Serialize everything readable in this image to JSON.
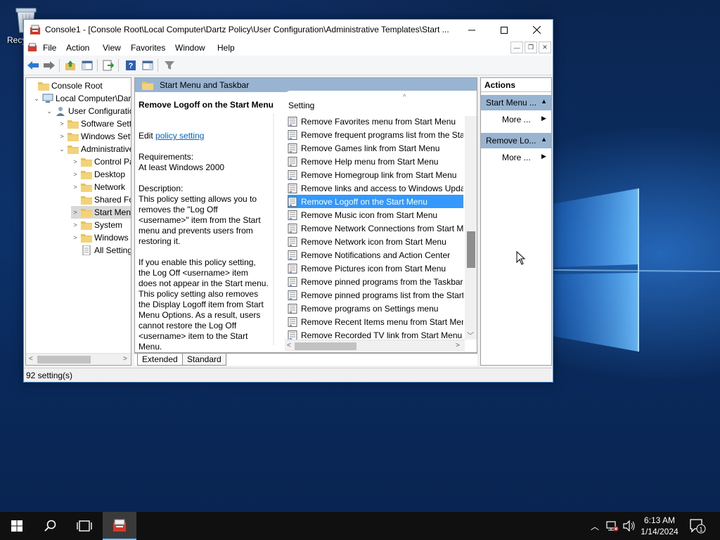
{
  "desktop": {
    "recycle_bin_label": "Recycle Bin"
  },
  "window": {
    "title": "Console1 - [Console Root\\Local Computer\\Dartz Policy\\User Configuration\\Administrative Templates\\Start ...",
    "controls": {
      "minimize": "—",
      "maximize": "☐",
      "close": "✕"
    }
  },
  "menubar": [
    "File",
    "Action",
    "View",
    "Favorites",
    "Window",
    "Help"
  ],
  "tree": {
    "items": [
      {
        "label": "Console Root",
        "level": 0,
        "expander": "",
        "icon": "folder-icon"
      },
      {
        "label": "Local Computer\\Dartz",
        "level": 1,
        "expander": "v",
        "icon": "computer-icon"
      },
      {
        "label": "User Configuration",
        "level": 2,
        "expander": "v",
        "icon": "user-icon"
      },
      {
        "label": "Software Settings",
        "level": 3,
        "expander": ">",
        "icon": "folder-icon"
      },
      {
        "label": "Windows Settings",
        "level": 3,
        "expander": ">",
        "icon": "folder-icon"
      },
      {
        "label": "Administrative Templates",
        "level": 3,
        "expander": "v",
        "icon": "folder-icon"
      },
      {
        "label": "Control Panel",
        "level": 4,
        "expander": ">",
        "icon": "folder-icon"
      },
      {
        "label": "Desktop",
        "level": 4,
        "expander": ">",
        "icon": "folder-icon"
      },
      {
        "label": "Network",
        "level": 4,
        "expander": ">",
        "icon": "folder-icon"
      },
      {
        "label": "Shared Folders",
        "level": 4,
        "expander": "",
        "icon": "folder-icon"
      },
      {
        "label": "Start Menu and Taskbar",
        "level": 4,
        "expander": ">",
        "icon": "folder-icon",
        "selected": true
      },
      {
        "label": "System",
        "level": 4,
        "expander": ">",
        "icon": "folder-icon"
      },
      {
        "label": "Windows Components",
        "level": 4,
        "expander": ">",
        "icon": "folder-icon"
      },
      {
        "label": "All Settings",
        "level": 4,
        "expander": "",
        "icon": "settings-page-icon"
      }
    ]
  },
  "details": {
    "header": "Start Menu and Taskbar",
    "description": {
      "title": "Remove Logoff on the Start Menu",
      "edit_prefix": "Edit",
      "edit_link": "policy setting",
      "requirements_label": "Requirements:",
      "requirements_value": "At least Windows 2000",
      "description_label": "Description:",
      "paragraph1": "This policy setting allows you to removes the \"Log Off <username>\" item from the Start menu and prevents users from restoring it.",
      "paragraph2": "If you enable this policy setting, the Log Off <username> item does not appear in the Start menu. This policy setting also removes the Display Logoff item from Start Menu Options. As a result, users cannot restore the Log Off <username> item to the Start Menu."
    },
    "column_header": "Setting",
    "settings": [
      "Remove Favorites menu from Start Menu",
      "Remove frequent programs list from the Start Menu",
      "Remove Games link from Start Menu",
      "Remove Help menu from Start Menu",
      "Remove Homegroup link from Start Menu",
      "Remove links and access to Windows Update",
      "Remove Logoff on the Start Menu",
      "Remove Music icon from Start Menu",
      "Remove Network Connections from Start Menu",
      "Remove Network icon from Start Menu",
      "Remove Notifications and Action Center",
      "Remove Pictures icon from Start Menu",
      "Remove pinned programs from the Taskbar",
      "Remove pinned programs list from the Start Menu",
      "Remove programs on Settings menu",
      "Remove Recent Items menu from Start Menu",
      "Remove Recorded TV link from Start Menu"
    ],
    "selected_index": 6
  },
  "tabs": [
    "Extended",
    "Standard"
  ],
  "actions": {
    "title": "Actions",
    "sections": [
      {
        "label": "Start Menu ...",
        "item": "More ..."
      },
      {
        "label": "Remove Lo...",
        "item": "More ..."
      }
    ]
  },
  "statusbar": {
    "text": "92 setting(s)"
  },
  "taskbar": {
    "time": "6:13 AM",
    "date": "1/14/2024",
    "notification_count": "1"
  }
}
